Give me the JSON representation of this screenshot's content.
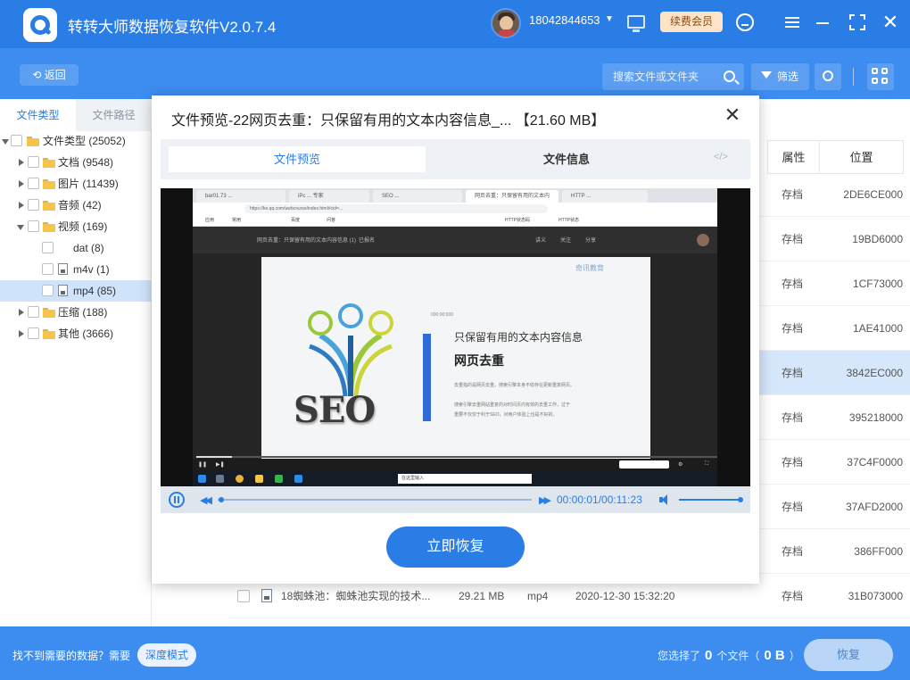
{
  "app": {
    "title": "转转大师数据恢复软件V2.0.7.4"
  },
  "user": {
    "phone": "18042844653",
    "vip_label": "续费会员"
  },
  "toolbar": {
    "back_label": "返回",
    "search_placeholder": "搜索文件或文件夹",
    "filter_label": "筛选"
  },
  "sidebar": {
    "tabs": [
      "文件类型",
      "文件路径"
    ],
    "tree": [
      {
        "label": "文件类型 (25052)",
        "level": 0,
        "expanded": true
      },
      {
        "label": "文档 (9548)",
        "level": 1,
        "expanded": false
      },
      {
        "label": "图片 (11439)",
        "level": 1,
        "expanded": false
      },
      {
        "label": "音频 (42)",
        "level": 1,
        "expanded": false
      },
      {
        "label": "视频 (169)",
        "level": 1,
        "expanded": true
      },
      {
        "label": "dat (8)",
        "level": 2
      },
      {
        "label": "m4v (1)",
        "level": 2
      },
      {
        "label": "mp4 (85)",
        "level": 2,
        "selected": true
      },
      {
        "label": "压缩 (188)",
        "level": 1,
        "expanded": false
      },
      {
        "label": "其他 (3666)",
        "level": 1,
        "expanded": false
      }
    ]
  },
  "table": {
    "columns": {
      "attr": "属性",
      "position": "位置"
    },
    "rows": [
      {
        "attr": "存档",
        "position": "2DE6CE000"
      },
      {
        "attr": "存档",
        "position": "19BD6000"
      },
      {
        "attr": "存档",
        "position": "1CF73000"
      },
      {
        "attr": "存档",
        "position": "1AE41000"
      },
      {
        "attr": "存档",
        "position": "3842EC000",
        "highlight": true
      },
      {
        "attr": "存档",
        "position": "395218000"
      },
      {
        "attr": "存档",
        "position": "37C4F0000"
      },
      {
        "attr": "存档",
        "position": "37AFD2000"
      },
      {
        "attr": "存档",
        "position": "386FF000"
      },
      {
        "name": "18蜘蛛池：蜘蛛池实现的技术...",
        "size": "29.21 MB",
        "type": "mp4",
        "date": "2020-12-30 15:32:20",
        "attr": "存档",
        "position": "31B073000"
      }
    ]
  },
  "modal": {
    "title": "文件预览-22网页去重：只保留有用的文本内容信息_... 【21.60 MB】",
    "tabs": [
      "文件预览",
      "文件信息"
    ],
    "code_symbol": "</>",
    "player": {
      "time": "00:00:01/00:11:23",
      "progress": 0.0015,
      "volume": 1.0
    },
    "restore_label": "立即恢复",
    "video": {
      "browser_tabs": [
        "bar01.73 ...",
        "iPc ... 专家",
        "SEO ...",
        "网页去重：只保留有用的文本内容...",
        "HTTP ..."
      ],
      "url": "https://ke.qq.com/webcourse/index.html#cid=...",
      "bookmarks": [
        "应用",
        "常用",
        "百度",
        "问答",
        "HTTP状态码",
        "HTTP状态"
      ],
      "nav_items": [
        "网页去重：只保留有用的文本内容信息 (1)",
        "已报名",
        "讲义",
        "关注",
        "分享"
      ],
      "slide": {
        "logo": "奇讯教育",
        "stamp": "000:00:000",
        "seo": "SEO",
        "heading": "只保留有用的文本内容信息",
        "bold": "网页去重",
        "line1": "去重指的是网页去重，搜索引擎本身不收存在更新重复网页。",
        "line2": "搜索引擎去重网站重复的对时间页内有效的去重工作，过于",
        "line3": "重要不仅仅于利于SEO，对用户体验上也是不好的。"
      },
      "taskbar_search": "在这里输入"
    }
  },
  "bottom": {
    "cant_find": "找不到需要的数据？需要",
    "deep_mode": "深度模式",
    "selected_prefix": "您选择了",
    "selected_count": "0",
    "selected_mid": "个文件（",
    "selected_size": "0 B",
    "selected_suffix": "）",
    "recover_label": "恢复"
  }
}
